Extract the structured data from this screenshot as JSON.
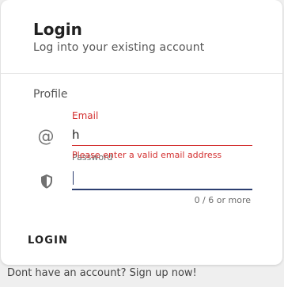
{
  "header": {
    "title": "Login",
    "subtitle": "Log into your existing account"
  },
  "form": {
    "section_label": "Profile",
    "email": {
      "icon": "at-icon",
      "label": "Email",
      "value": "h",
      "error": "Please enter a valid email address"
    },
    "password": {
      "icon": "shield-icon",
      "label": "Password",
      "value": "",
      "counter": "0 / 6 or more"
    },
    "submit_label": "LOGIN"
  },
  "footer": {
    "signup_text": "Dont have an account? Sign up now!"
  },
  "colors": {
    "error": "#d32f2f",
    "focus": "#2c3e70",
    "background": "#efefef"
  }
}
